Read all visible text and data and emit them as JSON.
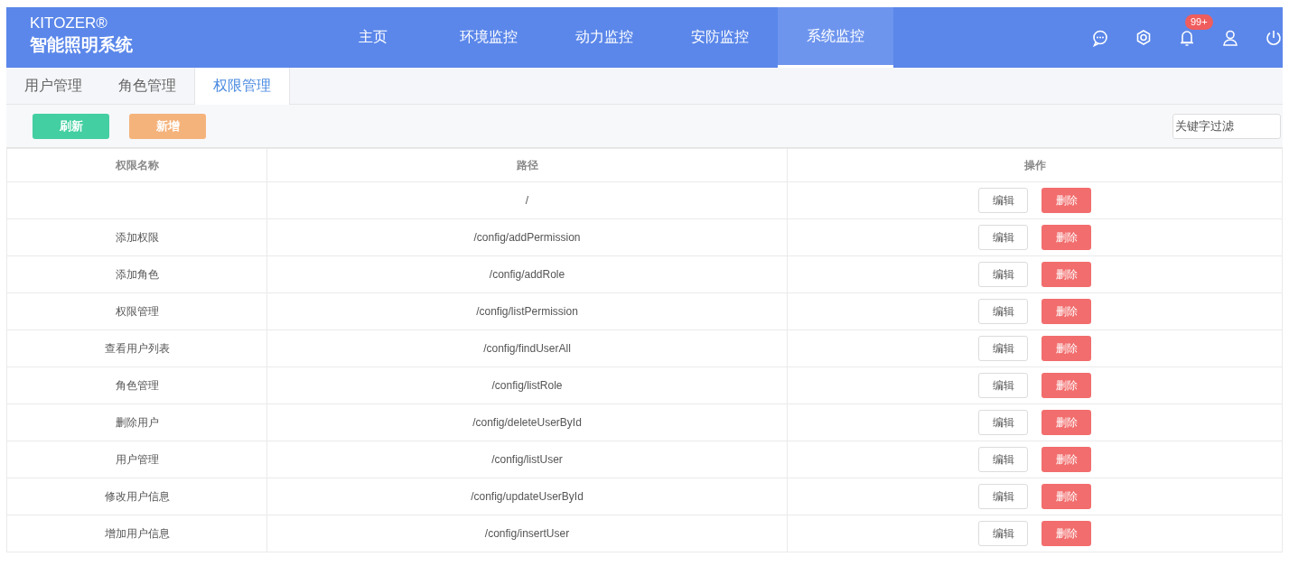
{
  "header": {
    "brand": "KITOZER®",
    "title": "智能照明系统",
    "nav": [
      {
        "label": "主页",
        "selected": false
      },
      {
        "label": "环境监控",
        "selected": false
      },
      {
        "label": "动力监控",
        "selected": false
      },
      {
        "label": "安防监控",
        "selected": false
      },
      {
        "label": "系统监控",
        "selected": true
      }
    ],
    "notification_badge": "99+"
  },
  "tabs": [
    {
      "label": "用户管理",
      "selected": false
    },
    {
      "label": "角色管理",
      "selected": false
    },
    {
      "label": "权限管理",
      "selected": true
    }
  ],
  "toolbar": {
    "buttons": [
      {
        "label": "刷新",
        "kind": "refresh"
      },
      {
        "label": "新增",
        "kind": "add"
      }
    ],
    "filter": {
      "placeholder": "关键字过滤"
    }
  },
  "table": {
    "columns": [
      "权限名称",
      "路径",
      "操作"
    ],
    "rows": [
      {
        "name": "",
        "path": "/",
        "actions": [
          "编辑",
          "删除"
        ]
      },
      {
        "name": "添加权限",
        "path": "/config/addPermission",
        "actions": [
          "编辑",
          "删除"
        ]
      },
      {
        "name": "添加角色",
        "path": "/config/addRole",
        "actions": [
          "编辑",
          "删除"
        ]
      },
      {
        "name": "权限管理",
        "path": "/config/listPermission",
        "actions": [
          "编辑",
          "删除"
        ]
      },
      {
        "name": "查看用户列表",
        "path": "/config/findUserAll",
        "actions": [
          "编辑",
          "删除"
        ]
      },
      {
        "name": "角色管理",
        "path": "/config/listRole",
        "actions": [
          "编辑",
          "删除"
        ]
      },
      {
        "name": "删除用户",
        "path": "/config/deleteUserById",
        "actions": [
          "编辑",
          "删除"
        ]
      },
      {
        "name": "用户管理",
        "path": "/config/listUser",
        "actions": [
          "编辑",
          "删除"
        ]
      },
      {
        "name": "修改用户信息",
        "path": "/config/updateUserById",
        "actions": [
          "编辑",
          "删除"
        ]
      },
      {
        "name": "增加用户信息",
        "path": "/config/insertUser",
        "actions": [
          "编辑",
          "删除"
        ]
      }
    ]
  }
}
